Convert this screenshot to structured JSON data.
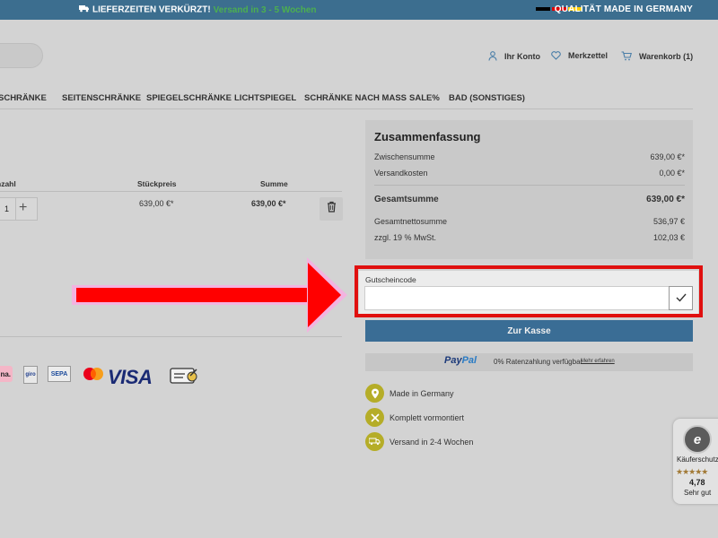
{
  "topbar": {
    "lead": "LIEFERZEITEN VERKÜRZT!",
    "highlight": "Versand in 3 - 5 Wochen",
    "quality": "QUALITÄT MADE IN GERMANY",
    "flag_colors": [
      "#000000",
      "#dd0000",
      "#ffce00"
    ]
  },
  "header": {
    "account": "Ihr Konto",
    "wishlist": "Merkzettel",
    "cart": "Warenkorb (1)"
  },
  "nav": {
    "items": [
      "SCHRÄNKE",
      "SEITENSCHRÄNKE",
      "SPIEGELSCHRÄNKE",
      "LICHTSPIEGEL",
      "SCHRÄNKE NACH MASS",
      "SALE%",
      "BAD (SONSTIGES)"
    ]
  },
  "cart": {
    "col_qty": "nzahl",
    "col_unit_price": "Stückpreis",
    "col_sum": "Summe",
    "item": {
      "quantity": "1",
      "unit_price": "639,00 €*",
      "total": "639,00 €*"
    }
  },
  "payment_methods": [
    "klarna",
    "giropay",
    "SEPA",
    "mastercard",
    "VISA",
    "invoice"
  ],
  "payment_labels": {
    "klarna": "na.",
    "giro": "giro",
    "sepa": "SEPA",
    "visa": "VISA"
  },
  "summary": {
    "title": "Zusammenfassung",
    "subtotal_label": "Zwischensumme",
    "subtotal_value": "639,00 €*",
    "shipping_label": "Versandkosten",
    "shipping_value": "0,00 €*",
    "total_label": "Gesamtsumme",
    "total_value": "639,00 €*",
    "net_label": "Gesamtnettosumme",
    "net_value": "536,97 €",
    "vat_label": "zzgl. 19 % MwSt.",
    "vat_value": "102,03 €"
  },
  "coupon": {
    "label": "Gutscheincode",
    "value": "",
    "placeholder": ""
  },
  "checkout": {
    "button": "Zur Kasse"
  },
  "paypal": {
    "logo_pay": "Pay",
    "logo_pal": "Pal",
    "text": "0% Ratenzahlung verfügbar.",
    "link": "Mehr erfahren"
  },
  "features": [
    {
      "icon": "location-pin-icon",
      "label": "Made in Germany"
    },
    {
      "icon": "tools-icon",
      "label": "Komplett vormontiert"
    },
    {
      "icon": "delivery-truck-icon",
      "label": "Versand in 2-4 Wochen"
    }
  ],
  "trusted_shops": {
    "seal_letter": "e",
    "label": "Käuferschutz",
    "stars": "★★★★★",
    "score": "4,78",
    "grade": "Sehr gut"
  },
  "colors": {
    "topbar": "#3c6e8f",
    "highlight_green": "#4caf50",
    "checkout_blue": "#3a6d95",
    "feature_icon": "#b5ad28",
    "annotation_red": "#e0100f"
  }
}
